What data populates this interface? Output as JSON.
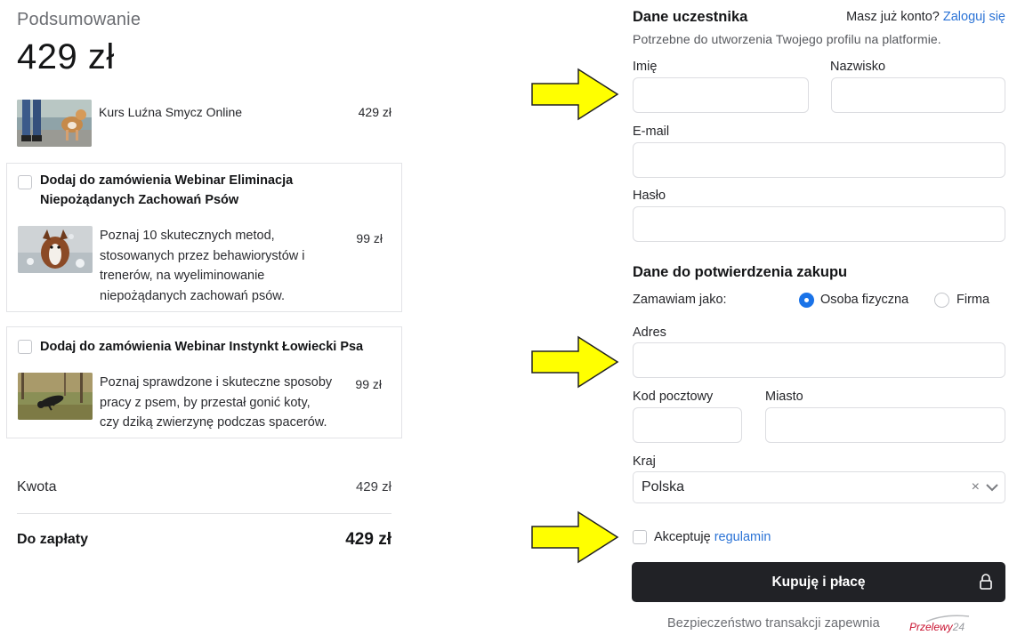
{
  "summary": {
    "heading": "Podsumowanie",
    "total": "429 zł",
    "product": {
      "name": "Kurs Luźna Smycz Online",
      "price": "429 zł"
    },
    "addons": [
      {
        "title_line1": "Dodaj do zamówienia Webinar Eliminacja",
        "title_line2": "Niepożądanych Zachowań Psów",
        "desc_lines": [
          "Poznaj 10 skutecznych metod,",
          "stosowanych przez behawiorystów i",
          "trenerów, na wyeliminowanie",
          "niepożądanych zachowań psów."
        ],
        "price": "99 zł",
        "checked": false
      },
      {
        "title_line1": "Dodaj do zamówienia Webinar Instynkt Łowiecki Psa",
        "desc_lines": [
          "Poznaj sprawdzone i skuteczne sposoby",
          "pracy z psem, by przestał gonić koty,",
          "czy dziką zwierzynę podczas spacerów."
        ],
        "price": "99 zł",
        "checked": false
      }
    ],
    "amount_label": "Kwota",
    "amount_value": "429 zł",
    "to_pay_label": "Do zapłaty",
    "to_pay_value": "429 zł"
  },
  "participant": {
    "title": "Dane uczestnika",
    "have_account": "Masz już konto?",
    "login_link": "Zaloguj się",
    "subtitle": "Potrzebne do utworzenia Twojego profilu na platformie.",
    "first_name_label": "Imię",
    "last_name_label": "Nazwisko",
    "email_label": "E-mail",
    "password_label": "Hasło",
    "first_name_value": "",
    "last_name_value": "",
    "email_value": "",
    "password_value": ""
  },
  "purchase": {
    "title": "Dane do potwierdzenia zakupu",
    "order_as_label": "Zamawiam jako:",
    "option_person": "Osoba fizyczna",
    "option_company": "Firma",
    "selected_option": "Osoba fizyczna",
    "address_label": "Adres",
    "postal_label": "Kod pocztowy",
    "city_label": "Miasto",
    "country_label": "Kraj",
    "country_value": "Polska",
    "clear_symbol": "×"
  },
  "terms": {
    "accept_text": "Akceptuję",
    "terms_link": "regulamin",
    "checked": false
  },
  "buy_button": {
    "label": "Kupuję i płacę",
    "icon": "lock-icon"
  },
  "footer": {
    "secure_text": "Bezpieczeństwo transakcji zapewnia",
    "logo_word": "Przelewy",
    "logo_num": "24"
  },
  "colors": {
    "accent": "#1a73e8",
    "link": "#2b73d6",
    "button": "#212226",
    "arrow_fill": "#ffff00"
  }
}
